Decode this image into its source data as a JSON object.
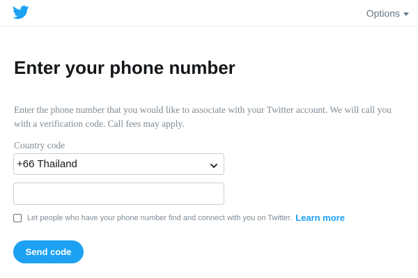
{
  "header": {
    "logo_icon": "twitter-bird-icon",
    "options_label": "Options",
    "brand_color": "#1da1f2"
  },
  "main": {
    "title": "Enter your phone number",
    "description": "Enter the phone number that you would like to associate with your Twitter account. We will call you with a verification code. Call fees may apply.",
    "country_code_label": "Country code",
    "country_code_value": "+66 Thailand",
    "phone_value": "",
    "discoverable_label": "Let people who have your phone number find and connect with you on Twitter.",
    "learn_more_label": "Learn more",
    "send_code_label": "Send code"
  }
}
